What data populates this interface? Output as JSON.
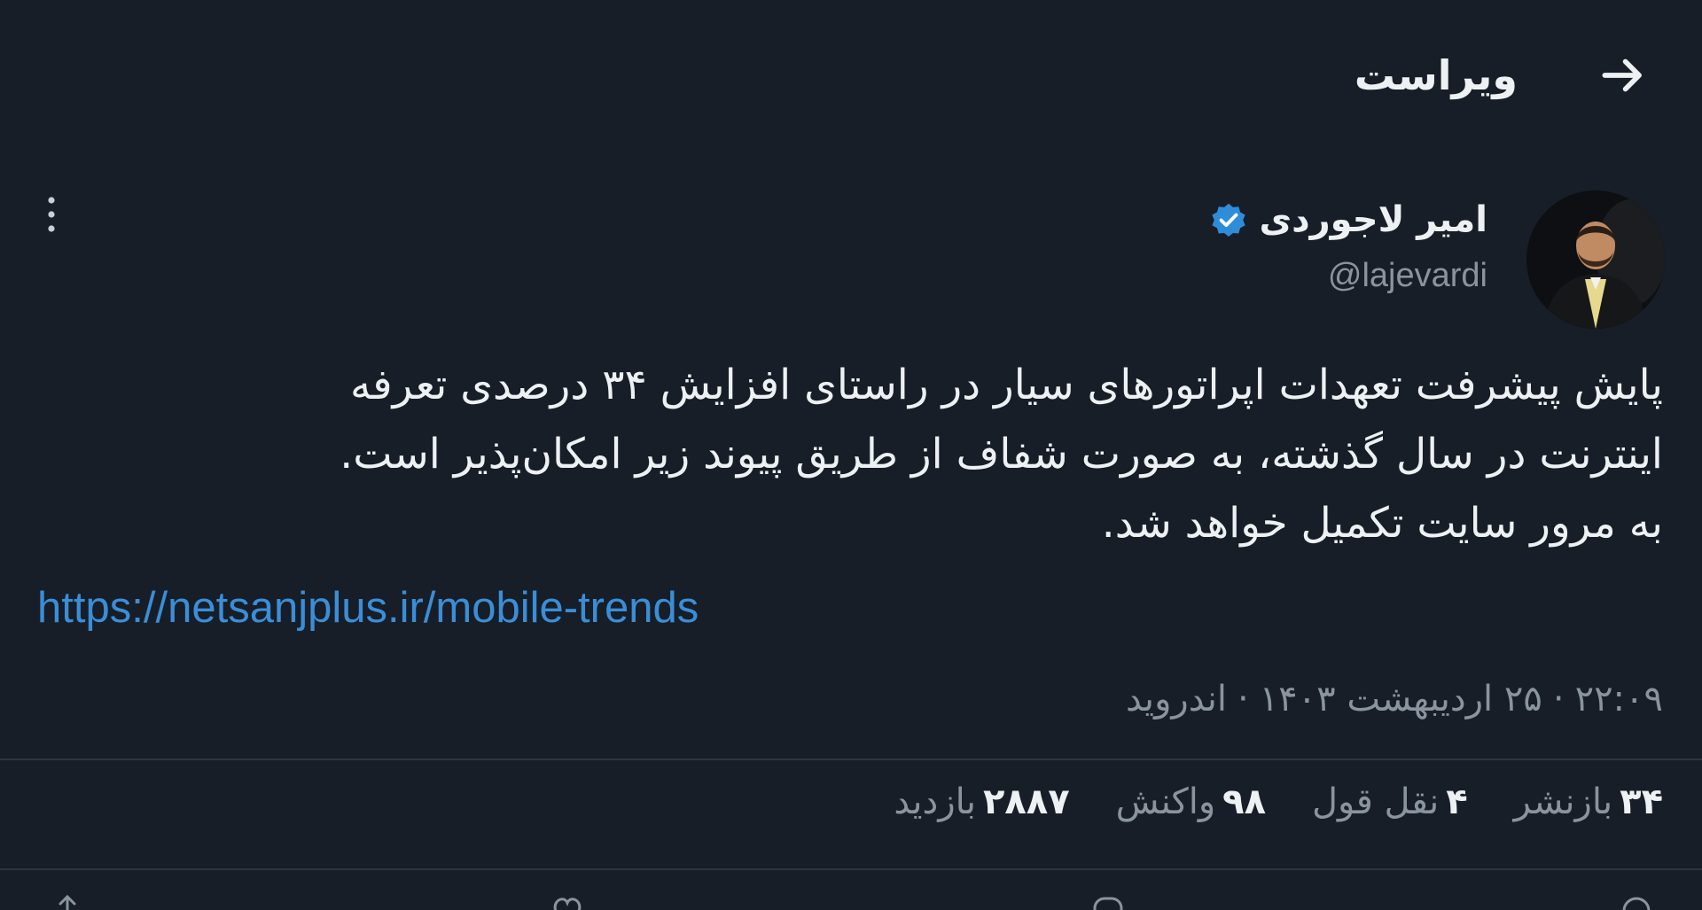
{
  "header": {
    "title": "ویراست",
    "back_icon": "arrow-right-icon"
  },
  "author": {
    "name": "امیر لاجوردی",
    "handle": "@lajevardi",
    "verified_icon": "verified-badge-icon",
    "verified_color": "#2f8cd8"
  },
  "tweet": {
    "lines": [
      "پایش پیشرفت تعهدات اپراتورهای سیار در راستای افزایش ۳۴ درصدی تعرفه",
      "اینترنت در سال گذشته، به صورت شفاف از طریق پیوند زیر امکان‌پذیر است.",
      "به مرور سایت تکمیل خواهد شد."
    ],
    "link": "https://netsanjplus.ir/mobile-trends",
    "link_color": "#3a8ed8"
  },
  "meta": {
    "time": "۲۲:۰۹",
    "date": "۲۵ اردیبهشت ۱۴۰۳",
    "source": "اندروید",
    "separator": "·"
  },
  "stats": [
    {
      "num": "۳۴",
      "label": "بازنشر"
    },
    {
      "num": "۴",
      "label": "نقل قول"
    },
    {
      "num": "۹۸",
      "label": "واکنش"
    },
    {
      "num": "۲۸۸۷",
      "label": "بازدید"
    }
  ],
  "colors": {
    "background": "#171e27",
    "text": "#eef1f3",
    "muted": "#8a949e",
    "divider": "#2c3640"
  }
}
